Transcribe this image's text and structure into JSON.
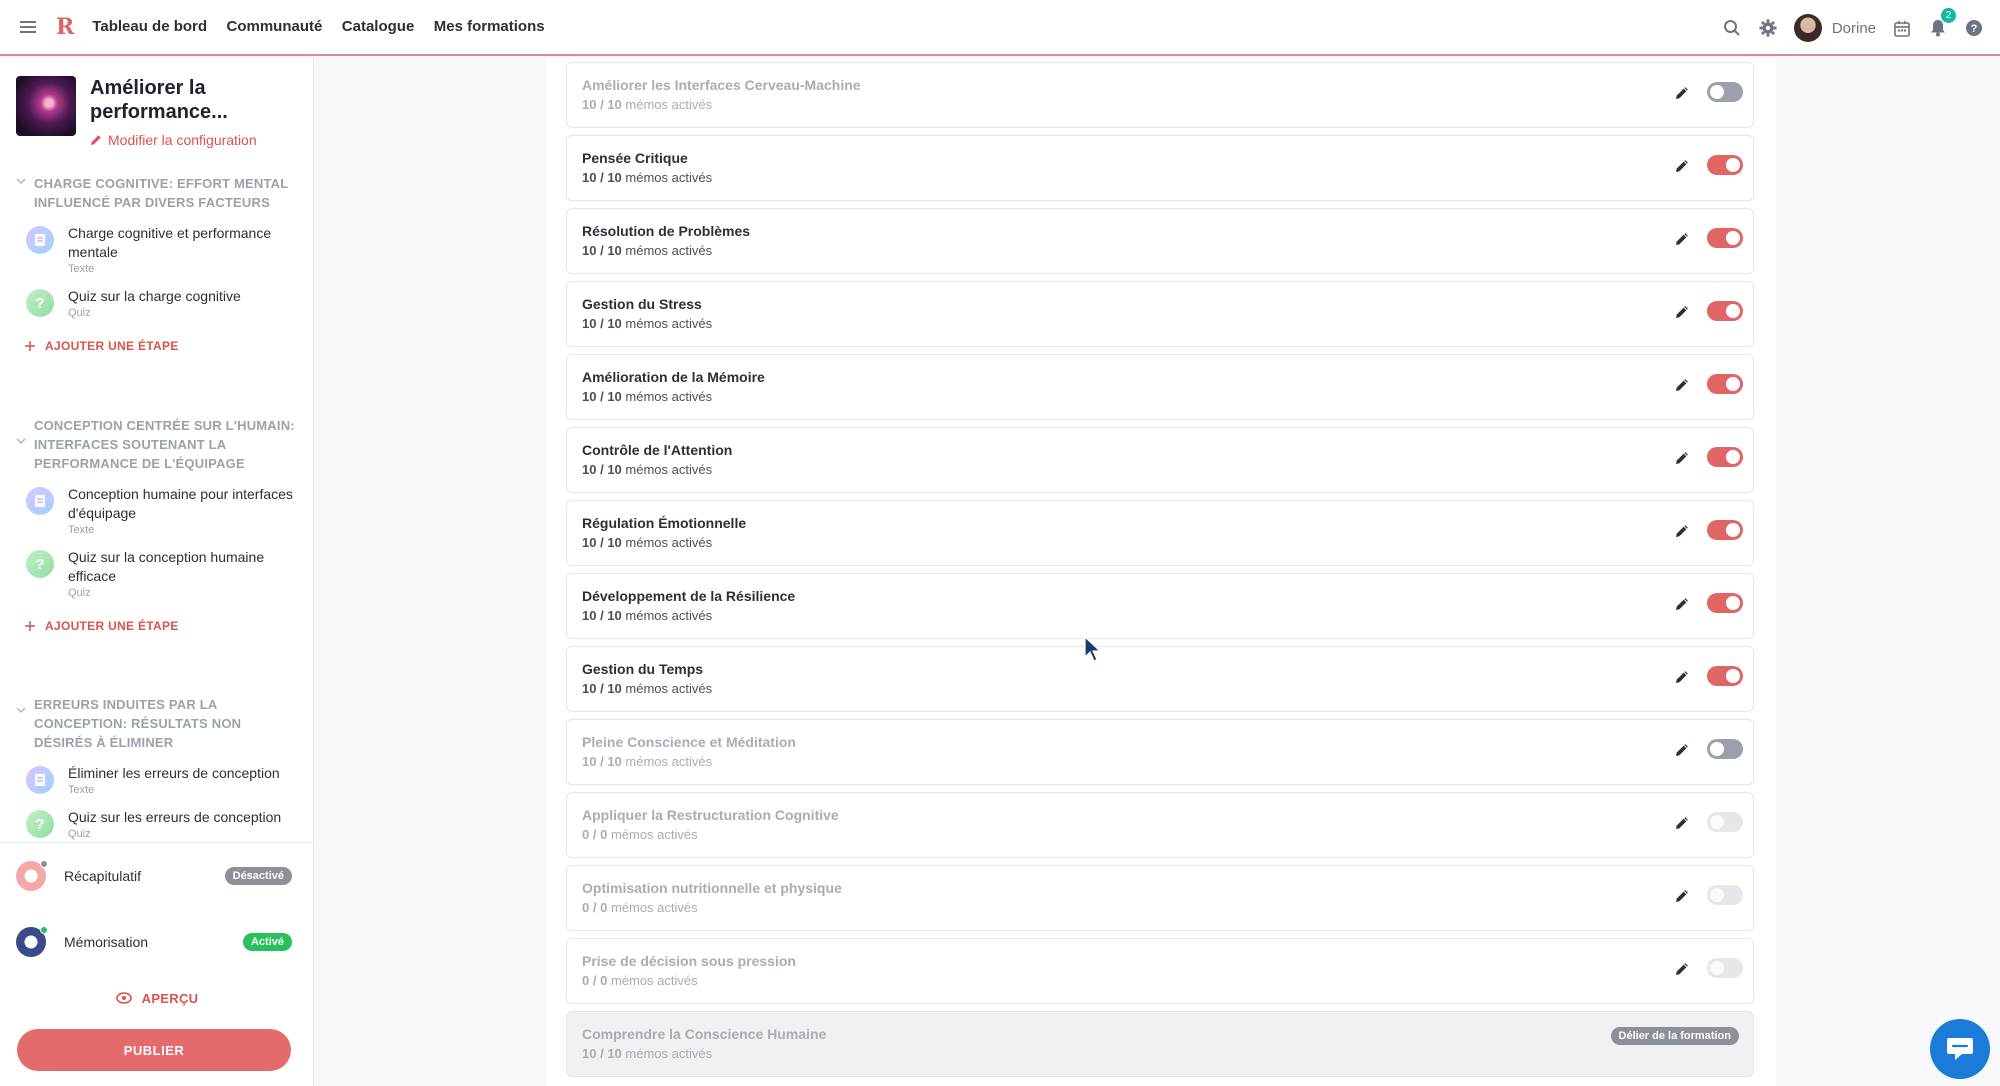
{
  "topbar": {
    "logo": "R",
    "nav": [
      "Tableau de bord",
      "Communauté",
      "Catalogue",
      "Mes formations"
    ],
    "user_name": "Dorine",
    "notification_count": "2"
  },
  "sidebar": {
    "course_title": "Améliorer la performance...",
    "config_link": "Modifier la configuration",
    "sections": [
      {
        "title": "CHARGE COGNITIVE: EFFORT MENTAL INFLUENCÉ PAR DIVERS FACTEURS",
        "steps": [
          {
            "name": "Charge cognitive et performance mentale",
            "type": "Texte",
            "kind": "text"
          },
          {
            "name": "Quiz sur la charge cognitive",
            "type": "Quiz",
            "kind": "quiz"
          }
        ],
        "add_step": "AJOUTER UNE ÉTAPE"
      },
      {
        "title": "CONCEPTION CENTRÉE SUR L'HUMAIN: INTERFACES SOUTENANT LA PERFORMANCE DE L'ÉQUIPAGE",
        "steps": [
          {
            "name": "Conception humaine pour interfaces d'équipage",
            "type": "Texte",
            "kind": "text"
          },
          {
            "name": "Quiz sur la conception humaine efficace",
            "type": "Quiz",
            "kind": "quiz"
          }
        ],
        "add_step": "AJOUTER UNE ÉTAPE"
      },
      {
        "title": "ERREURS INDUITES PAR LA CONCEPTION: RÉSULTATS NON DÉSIRÉS À ÉLIMINER",
        "steps": [
          {
            "name": "Éliminer les erreurs de conception",
            "type": "Texte",
            "kind": "text"
          },
          {
            "name": "Quiz sur les erreurs de conception",
            "type": "Quiz",
            "kind": "quiz"
          }
        ]
      }
    ],
    "features": [
      {
        "name": "Récapitulatif",
        "status": "Désactivé",
        "status_color": "#8c9098",
        "dot_color": "#8c9098"
      },
      {
        "name": "Mémorisation",
        "status": "Activé",
        "status_color": "#27c05a",
        "dot_color": "#27c05a"
      }
    ],
    "preview_label": "APERÇU",
    "publish_label": "PUBLIER"
  },
  "memo_suffix": "mémos activés",
  "modules": [
    {
      "title": "Améliorer les Interfaces Cerveau-Machine",
      "active": "10",
      "total": "10",
      "toggle": "off",
      "dim": true
    },
    {
      "title": "Pensée Critique",
      "active": "10",
      "total": "10",
      "toggle": "on",
      "dim": false
    },
    {
      "title": "Résolution de Problèmes",
      "active": "10",
      "total": "10",
      "toggle": "on",
      "dim": false
    },
    {
      "title": "Gestion du Stress",
      "active": "10",
      "total": "10",
      "toggle": "on",
      "dim": false
    },
    {
      "title": "Amélioration de la Mémoire",
      "active": "10",
      "total": "10",
      "toggle": "on",
      "dim": false
    },
    {
      "title": "Contrôle de l'Attention",
      "active": "10",
      "total": "10",
      "toggle": "on",
      "dim": false
    },
    {
      "title": "Régulation Émotionnelle",
      "active": "10",
      "total": "10",
      "toggle": "on",
      "dim": false
    },
    {
      "title": "Développement de la Résilience",
      "active": "10",
      "total": "10",
      "toggle": "on",
      "dim": false
    },
    {
      "title": "Gestion du Temps",
      "active": "10",
      "total": "10",
      "toggle": "on",
      "dim": false
    },
    {
      "title": "Pleine Conscience et Méditation",
      "active": "10",
      "total": "10",
      "toggle": "off",
      "dim": true
    },
    {
      "title": "Appliquer la Restructuration Cognitive",
      "active": "0",
      "total": "0",
      "toggle": "disabled",
      "dim": true
    },
    {
      "title": "Optimisation nutritionnelle et physique",
      "active": "0",
      "total": "0",
      "toggle": "disabled",
      "dim": true
    },
    {
      "title": "Prise de décision sous pression",
      "active": "0",
      "total": "0",
      "toggle": "disabled",
      "dim": true
    },
    {
      "title": "Comprendre la Conscience Humaine",
      "active": "10",
      "total": "10",
      "toggle": "none",
      "dim": true,
      "badge": "Délier de la formation"
    }
  ],
  "colors": {
    "accent": "#e06666",
    "active_green": "#27c05a",
    "chat": "#1a7bd8"
  }
}
